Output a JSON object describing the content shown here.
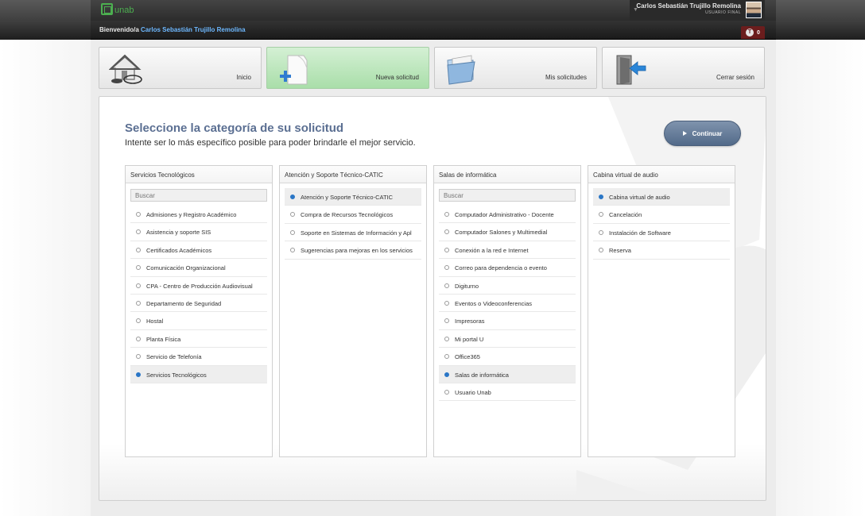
{
  "header": {
    "logo_text": "unab",
    "user_name": "Carlos Sebastián Trujillo Remolina",
    "user_role": "USUARIO FINAL",
    "welcome_prefix": "Bienvenido/a",
    "welcome_user": "Carlos Sebastián Trujillo Remolina",
    "notification_count": "0",
    "notification_letter": "T"
  },
  "nav": {
    "tiles": [
      {
        "label": "Inicio",
        "icon": "home-icon"
      },
      {
        "label": "Nueva solicitud",
        "icon": "new-request-icon"
      },
      {
        "label": "Mis solicitudes",
        "icon": "folder-icon"
      },
      {
        "label": "Cerrar sesión",
        "icon": "logout-door-icon"
      }
    ],
    "active_index": 1
  },
  "main": {
    "title": "Seleccione la categoría de su solicitud",
    "subtitle": "Intente ser lo más específico posible para poder brindarle el mejor servicio.",
    "continue_label": "Continuar",
    "columns": [
      {
        "header": "Servicios Tecnológicos",
        "search_placeholder": "Buscar",
        "items": [
          "Admisiones y Registro Académico",
          "Asistencia y soporte SIS",
          "Certificados Académicos",
          "Comunicación Organizacional",
          "CPA - Centro de Producción Audiovisual",
          "Departamento de Seguridad",
          "Hostal",
          "Planta Física",
          "Servicio de Telefonía",
          "Servicios Tecnológicos"
        ],
        "selected_index": 9
      },
      {
        "header": "Atención y Soporte Técnico-CATIC",
        "search_placeholder": "",
        "items": [
          "Atención y Soporte Técnico-CATIC",
          "Compra de Recursos Tecnológicos",
          "Soporte en Sistemas de Información y Apl",
          "Sugerencias para mejoras en los servicios"
        ],
        "selected_index": 0
      },
      {
        "header": "Salas de informática",
        "search_placeholder": "Buscar",
        "items": [
          "Computador Administrativo - Docente",
          "Computador Salones y Multimedial",
          "Conexión a la red e Internet",
          "Correo para dependencia o evento",
          "Digiturno",
          "Eventos o Videoconferencias",
          "Impresoras",
          "Mi portal U",
          "Office365",
          "Salas de informática",
          "Usuario Unab"
        ],
        "selected_index": 9
      },
      {
        "header": "Cabina virtual de audio",
        "search_placeholder": "",
        "items": [
          "Cabina virtual de audio",
          "Cancelación",
          "Instalación de Software",
          "Reserva"
        ],
        "selected_index": 0
      }
    ]
  }
}
